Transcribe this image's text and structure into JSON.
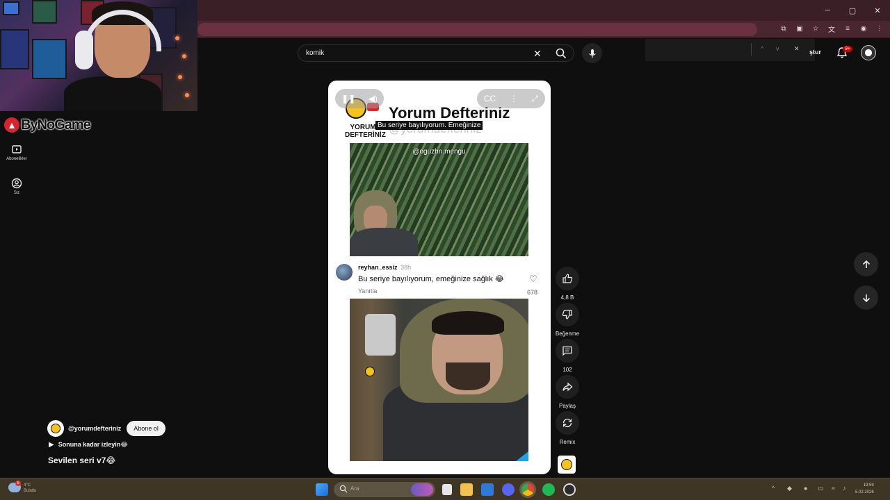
{
  "window": {
    "minimize": "─",
    "maximize": "▢",
    "close": "✕"
  },
  "streamer": {
    "logo_text": "ByNoGame"
  },
  "left_nav": {
    "items": [
      {
        "label": "Abonelikler",
        "icon": "subscriptions-icon"
      },
      {
        "label": "Siz",
        "icon": "account-icon"
      }
    ]
  },
  "search": {
    "value": "komik",
    "clear": "✕"
  },
  "header": {
    "create_label": "ştur",
    "notifications": "9+"
  },
  "findbar": {
    "up": "^",
    "down": "v",
    "close": "✕"
  },
  "player": {
    "brand_line1": "YORUM",
    "brand_line2": "DEFTERİNİZ",
    "title": "Yorum Defteriniz",
    "handle": "@yorumdefteriniz",
    "caption": "Bu seriye bayılıyorum. Emeğinize",
    "clip_handle": "@oguzhn.mengu",
    "comment": {
      "user": "reyhan_essiz",
      "time": "38h",
      "text": "Bu seriye bayılıyorum, emeğinize sağlık 😂",
      "reply": "Yanıtla",
      "likes": "678"
    }
  },
  "actions": [
    {
      "icon": "like-icon",
      "label": "4,8 B"
    },
    {
      "icon": "dislike-icon",
      "label": "Beğenme"
    },
    {
      "icon": "comment-icon",
      "label": "102"
    },
    {
      "icon": "share-icon",
      "label": "Paylaş"
    },
    {
      "icon": "remix-icon",
      "label": "Remix"
    }
  ],
  "channel": {
    "name": "@yorumdefteriniz",
    "subscribe": "Abone ol",
    "sound": "Sonuna kadar izleyin😂",
    "video_title": "Sevilen seri v7😂"
  },
  "taskbar": {
    "search_placeholder": "Ara",
    "weather_badge": "5",
    "weather_temp": "4°C",
    "weather_desc": "Bulutlu",
    "time": "19:59",
    "date": "5.02.2026"
  },
  "colors": {
    "background": "#0f0f0f",
    "titlebar": "#3b1f27",
    "addressbar": "#4a2630",
    "accent_red": "#cc0000",
    "taskbar": "#3e3525"
  }
}
